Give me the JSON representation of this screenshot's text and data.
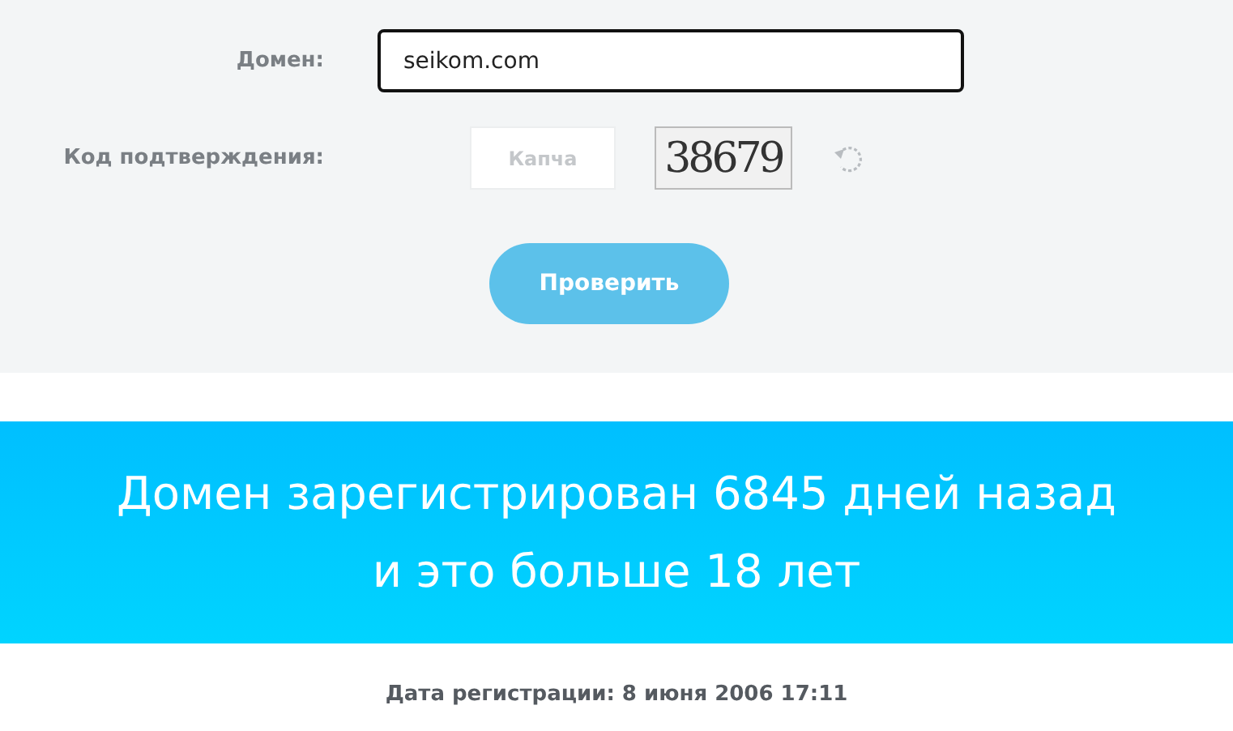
{
  "form": {
    "domain_label": "Домен:",
    "domain_value": "seikom.com",
    "captcha_label": "Код подтверждения:",
    "captcha_placeholder": "Капча",
    "captcha_image": "38679",
    "submit": "Проверить"
  },
  "banner": {
    "lines": [
      "Домен зарегистрирован 6845 дней назад",
      "и это больше 18 лет"
    ]
  },
  "registration_date": "Дата регистрации: 8 июня 2006 17:11"
}
